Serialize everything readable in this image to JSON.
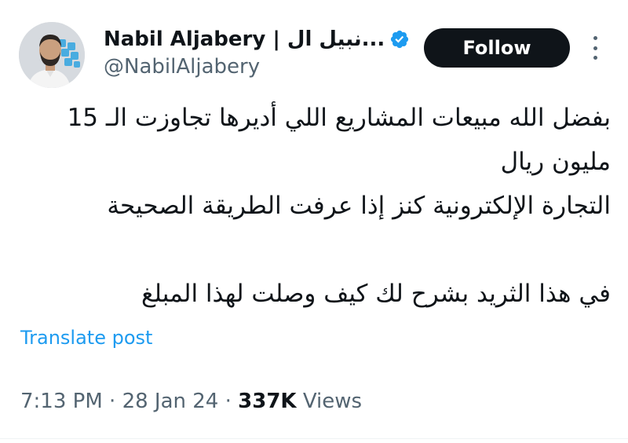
{
  "author": {
    "display_name": "Nabil Aljabery | نبيل ال...",
    "handle": "@NabilAljabery",
    "verified": true,
    "avatar": "profile-photo"
  },
  "follow_button": {
    "label": "Follow"
  },
  "more_menu": {
    "icon": "more-vertical-icon"
  },
  "tweet": {
    "lines": [
      "بفضل الله مبيعات المشاريع اللي أديرها تجاوزت الـ 15",
      "مليون ريال",
      "التجارة الإلكترونية كنز إذا عرفت الطريقة الصحيحة",
      "",
      "في هذا الثريد بشرح لك كيف وصلت لهذا المبلغ"
    ]
  },
  "translate": {
    "label": "Translate post"
  },
  "meta": {
    "time": "7:13 PM",
    "separator": "·",
    "date": "28 Jan 24",
    "views_count": "337K",
    "views_label": "Views"
  },
  "colors": {
    "accent": "#1d9bf0",
    "text": "#0f1419",
    "secondary": "#536471",
    "follow_bg": "#0f1419"
  }
}
